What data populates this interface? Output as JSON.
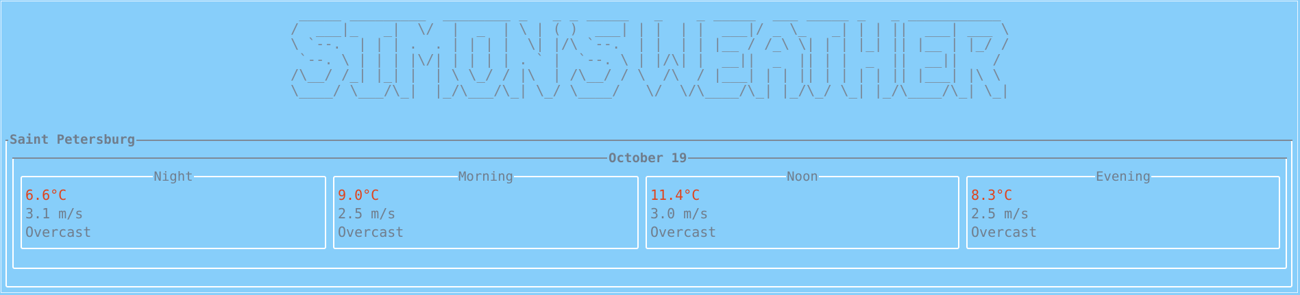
{
  "banner": {
    "lines": [
      " _____ _________  ________ _   _ _ _____   _    _ _____  ___ _____ _   _ ___________ ",
      "/  ___|_   _|  \\/  |  _  | \\ | ( )  ___| | |  | |  ___|/ _ \\_   _| | | ||  ___| ___ \\",
      "\\ `--.  | | | .  . | | | |  \\| |/\\ `--.  | |  | | |__ / /_\\ \\| | | |_| || |__ | |_/ /",
      " `--. \\ | | | |\\/| | | | | . ` |  `--. \\ | |/\\| |  __||  _  || | |  _  ||  __||    / ",
      "/\\__/ /_| |_| |  | \\ \\_/ / |\\  | /\\__/ / \\  /\\  / |___| | | || | | | | || |___| |\\ \\ ",
      "\\____/ \\___/\\_|  |_/\\___/\\_| \\_/ \\____/   \\/  \\/\\____/\\_| |_/\\_/ \\_| |_/\\____/\\_| \\_|"
    ]
  },
  "city": "Saint Petersburg",
  "date": "October 19",
  "periods": [
    {
      "label": "Night",
      "temp": "6.6°C",
      "wind": "3.1 m/s",
      "condition": "Overcast"
    },
    {
      "label": "Morning",
      "temp": "9.0°C",
      "wind": "2.5 m/s",
      "condition": "Overcast"
    },
    {
      "label": "Noon",
      "temp": "11.4°C",
      "wind": "3.0 m/s",
      "condition": "Overcast"
    },
    {
      "label": "Evening",
      "temp": "8.3°C",
      "wind": "2.5 m/s",
      "condition": "Overcast"
    }
  ],
  "colors": {
    "background": "#87cefa",
    "border": "#ffffff",
    "text": "#707d8c",
    "temperature": "#e0431b"
  }
}
